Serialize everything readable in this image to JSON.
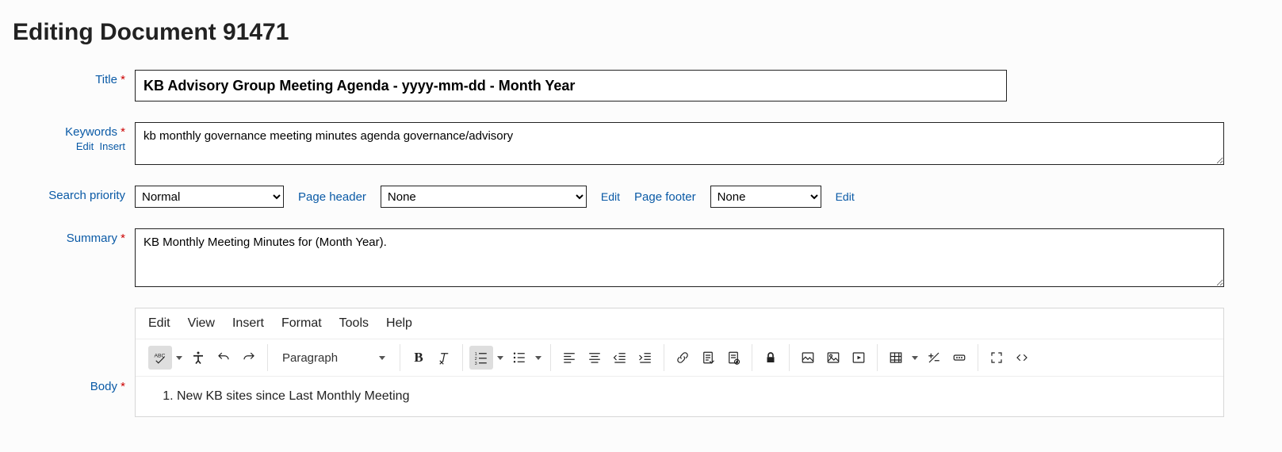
{
  "page_heading": "Editing Document 91471",
  "labels": {
    "title": "Title",
    "keywords": "Keywords",
    "keywords_edit": "Edit",
    "keywords_insert": "Insert",
    "search_priority": "Search priority",
    "page_header": "Page header",
    "page_footer": "Page footer",
    "edit_link": "Edit",
    "summary": "Summary",
    "body": "Body",
    "required_mark": "*"
  },
  "fields": {
    "title": "KB Advisory Group Meeting Agenda - yyyy-mm-dd - Month Year",
    "keywords": "kb monthly governance meeting minutes agenda governance/advisory",
    "search_priority_selected": "Normal",
    "page_header_selected": "None",
    "page_footer_selected": "None",
    "summary": "KB Monthly Meeting Minutes for (Month Year)."
  },
  "editor": {
    "menubar": [
      "Edit",
      "View",
      "Insert",
      "Format",
      "Tools",
      "Help"
    ],
    "block_format": "Paragraph",
    "content_item_1": "New KB sites since Last Monthly Meeting"
  }
}
